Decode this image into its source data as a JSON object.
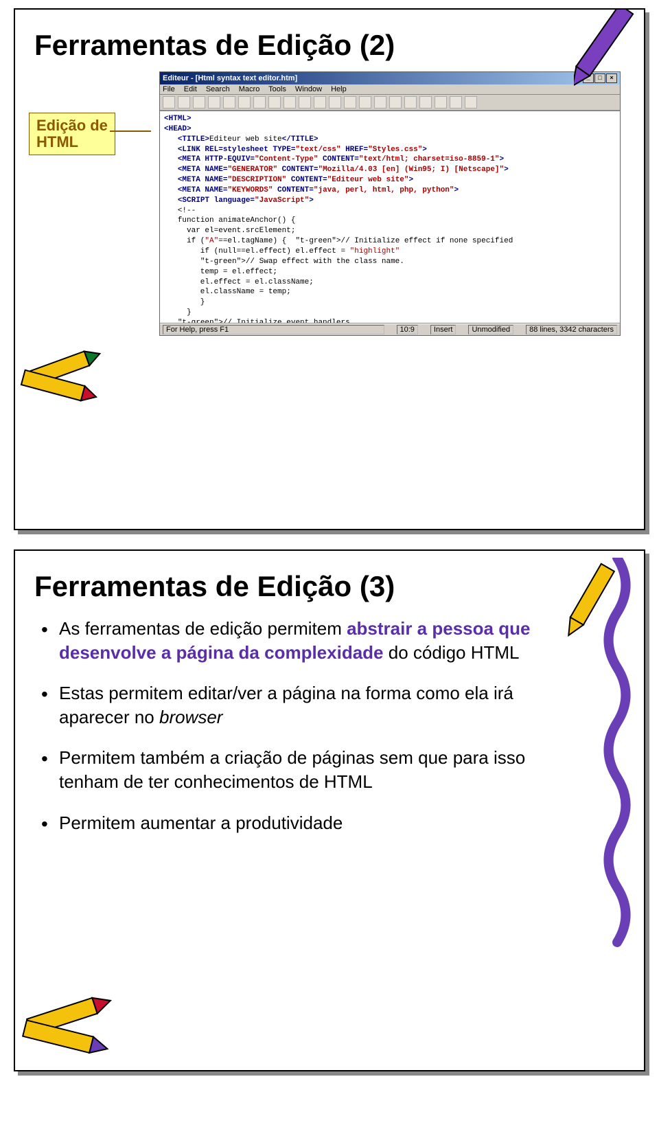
{
  "slide1": {
    "title": "Ferramentas de Edição (2)",
    "label": "Edição de\nHTML",
    "editor": {
      "title_prefix": "Editeur - [Html syntax text editor.htm]",
      "menu": [
        "File",
        "Edit",
        "Search",
        "Macro",
        "Tools",
        "Window",
        "Help"
      ],
      "code": "<HTML>\n<HEAD>\n   <TITLE>Editeur web site</TITLE>\n   <LINK REL=stylesheet TYPE=\"text/css\" HREF=\"Styles.css\">\n   <META HTTP-EQUIV=\"Content-Type\" CONTENT=\"text/html; charset=iso-8859-1\">\n   <META NAME=\"GENERATOR\" CONTENT=\"Mozilla/4.03 [en] (Win95; I) [Netscape]\">\n   <META NAME=\"DESCRIPTION\" CONTENT=\"Editeur web site\">\n   <META NAME=\"KEYWORDS\" CONTENT=\"java, perl, html, php, python\">\n   <SCRIPT language=\"JavaScript\">\n   <!--\n   function animateAnchor() {\n     var el=event.srcElement;\n     if (\"A\"==el.tagName) {  // Initialize effect if none specified\n        if (null==el.effect) el.effect = \"highlight\"\n        // Swap effect with the class name.\n        temp = el.effect;\n        el.effect = el.className;\n        el.className = temp;\n        }\n     }\n   // Initialize event handlers\n   document.onmouseover = animateAnchor;\n   document.onmouseout = animateAnchor;",
      "status": {
        "help": "For Help, press F1",
        "pos": "10:9",
        "mode": "Insert",
        "modified": "Unmodified",
        "stats": "88 lines, 3342 characters"
      }
    }
  },
  "slide2": {
    "title": "Ferramentas de Edição (3)",
    "bullets": [
      {
        "pre": "As ferramentas de edição permitem ",
        "emph": "abstrair a pessoa que desenvolve a página da complexidade",
        "post": " do código HTML"
      },
      {
        "text_pre": "Estas permitem editar/ver a página na forma como ela irá aparecer no ",
        "text_italic": "browser",
        "text_post": ""
      },
      {
        "plain": "Permitem também a criação de páginas sem que para isso tenham de ter conhecimentos de HTML"
      },
      {
        "plain": "Permitem aumentar a produtividade"
      }
    ]
  }
}
